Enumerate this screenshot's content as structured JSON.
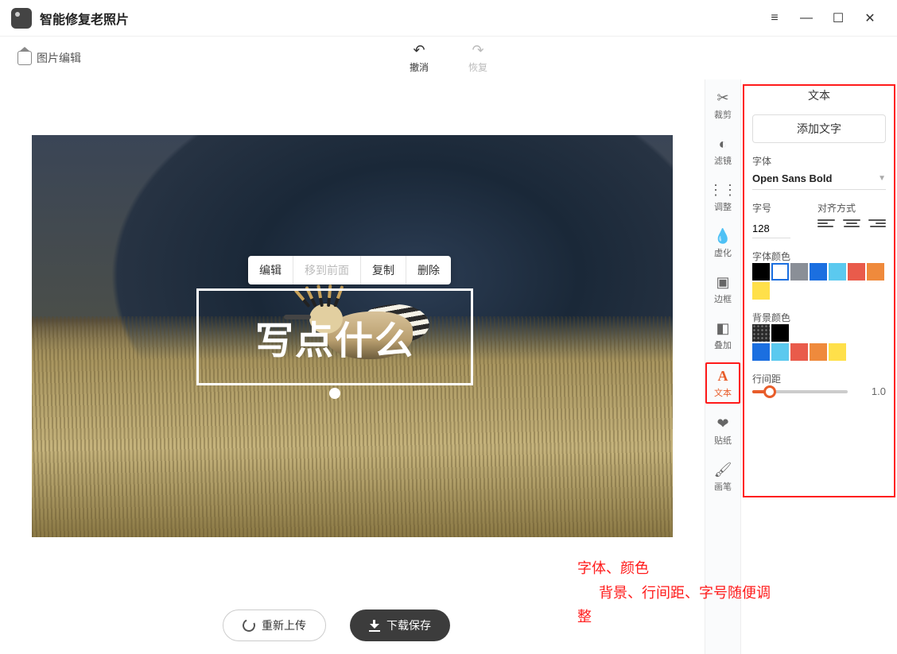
{
  "app": {
    "title": "智能修复老照片"
  },
  "toolbar": {
    "photo_edit": "图片编辑",
    "undo": "撤消",
    "redo": "恢复"
  },
  "canvas": {
    "minibar": {
      "edit": "编辑",
      "bring_front": "移到前面",
      "copy": "复制",
      "delete": "删除"
    },
    "text_placeholder": "写点什么"
  },
  "bottom": {
    "reupload": "重新上传",
    "download": "下载保存"
  },
  "tools": {
    "crop": "裁剪",
    "filter": "滤镜",
    "adjust": "调整",
    "blur": "虚化",
    "border": "边框",
    "overlay": "叠加",
    "text": "文本",
    "sticker": "贴纸",
    "brush": "画笔"
  },
  "panel": {
    "title": "文本",
    "add_text": "添加文字",
    "font_label": "字体",
    "font_value": "Open Sans Bold",
    "size_label": "字号",
    "size_value": "128",
    "align_label": "对齐方式",
    "font_color_label": "字体颜色",
    "bg_color_label": "背景颜色",
    "line_spacing_label": "行间距",
    "line_spacing_value": "1.0",
    "font_colors": [
      "#000000",
      "#ffffff",
      "#8a8f97",
      "#1b6fe0",
      "#5bc9ef",
      "#e95b4b",
      "#ef8a3c",
      "#ffe04a"
    ],
    "font_color_selected": 1,
    "bg_colors_left": [
      "dots",
      "#000000"
    ],
    "bg_colors_right": [
      "#1b6fe0",
      "#5bc9ef",
      "#e95b4b",
      "#ef8a3c",
      "#ffe04a"
    ]
  },
  "annotation": {
    "line1": "字体、颜色",
    "line2": "背景、行间距、字号随便调",
    "line3": "整"
  }
}
